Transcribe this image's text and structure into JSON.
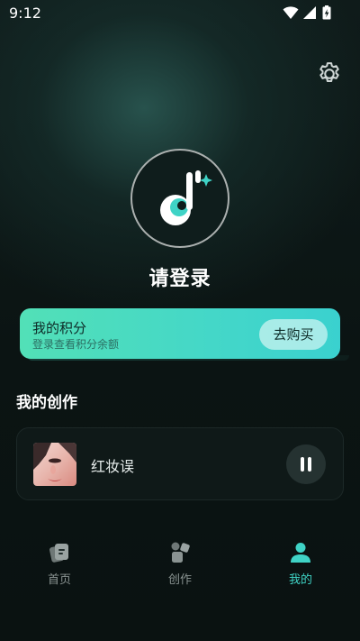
{
  "status_bar": {
    "time": "9:12"
  },
  "profile": {
    "login_prompt": "请登录"
  },
  "points": {
    "title": "我的积分",
    "subtitle": "登录查看积分余额",
    "buy_label": "去购买"
  },
  "creations": {
    "section_title": "我的创作",
    "items": [
      {
        "title": "红妆误"
      }
    ]
  },
  "nav": {
    "items": [
      {
        "label": "首页",
        "icon": "home-icon"
      },
      {
        "label": "创作",
        "icon": "create-icon"
      },
      {
        "label": "我的",
        "icon": "profile-icon"
      }
    ],
    "active": "我的"
  },
  "colors": {
    "accent": "#3fd3c6",
    "card_gradient_start": "#52e0b7",
    "card_gradient_end": "#3ad1cf",
    "background": "#0b1413"
  }
}
